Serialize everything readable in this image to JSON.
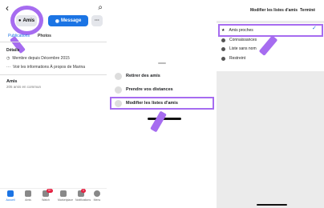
{
  "panel1": {
    "back_icon": "‹",
    "search_icon": "⌕",
    "buttons": {
      "amis": "Amis",
      "message": "Message",
      "more": "···"
    },
    "tabs": {
      "active": "Publications",
      "photos": "Photos"
    },
    "details": {
      "heading": "Détails",
      "member_since": "Membre depuis Décembre 2015",
      "about": "Voir les informations À propos de Marina"
    },
    "friends": {
      "heading": "Amis",
      "count": "205 amis en commun"
    },
    "bottom_nav": [
      {
        "label": "Accueil",
        "icon": "home-icon"
      },
      {
        "label": "Amis",
        "icon": "friends-icon"
      },
      {
        "label": "Watch",
        "icon": "watch-icon"
      },
      {
        "label": "Marketplace",
        "icon": "marketplace-icon"
      },
      {
        "label": "Notifications",
        "icon": "bell-icon"
      },
      {
        "label": "Menu",
        "icon": "menu-icon"
      }
    ],
    "badges": {
      "watch": "9+",
      "notifications": "1"
    }
  },
  "panel2": {
    "items": [
      "Retirer des amis",
      "Prendre vos distances",
      "Modifier les listes d'amis"
    ]
  },
  "panel3": {
    "title": "Modifier les listes d'amis",
    "done": "Terminé",
    "items": [
      "Amis proches",
      "Connaissances",
      "Liste sans nom",
      "Restreint"
    ],
    "check": "✓"
  },
  "colors": {
    "accent": "#1b74e4",
    "highlight": "#a66cf0",
    "badge": "#e41e3f"
  }
}
